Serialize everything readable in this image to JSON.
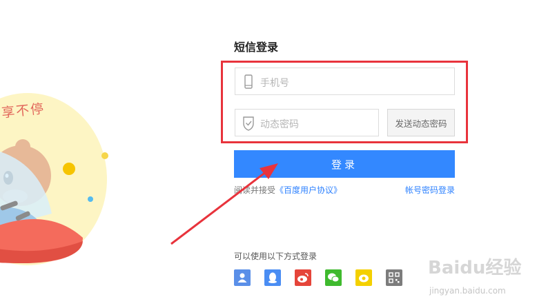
{
  "illustration": {
    "text": "享不停"
  },
  "login": {
    "title": "短信登录",
    "phone_placeholder": "手机号",
    "code_placeholder": "动态密码",
    "send_code_label": "发送动态密码",
    "submit_label": "登录",
    "agree_prefix": "阅读并接受",
    "agreement_link": "《百度用户协议》",
    "password_login_link": "帐号密码登录"
  },
  "other_login": {
    "label": "可以使用以下方式登录",
    "methods": [
      "user-icon",
      "qq-icon",
      "weibo-icon",
      "wechat-icon",
      "yy-icon",
      "qrcode-icon"
    ]
  },
  "colors": {
    "primary": "#3388ff",
    "highlight_box": "#e8333c",
    "link": "#2e82ff",
    "weibo": "#e5453a",
    "wechat": "#3fba2e",
    "yy": "#f4d000",
    "qq": "#4a8df3",
    "user": "#5a8fe8",
    "qrcode": "#7c7c7c"
  },
  "watermark": {
    "text": "Baidu经验",
    "sub": "jingyan.baidu.com"
  }
}
